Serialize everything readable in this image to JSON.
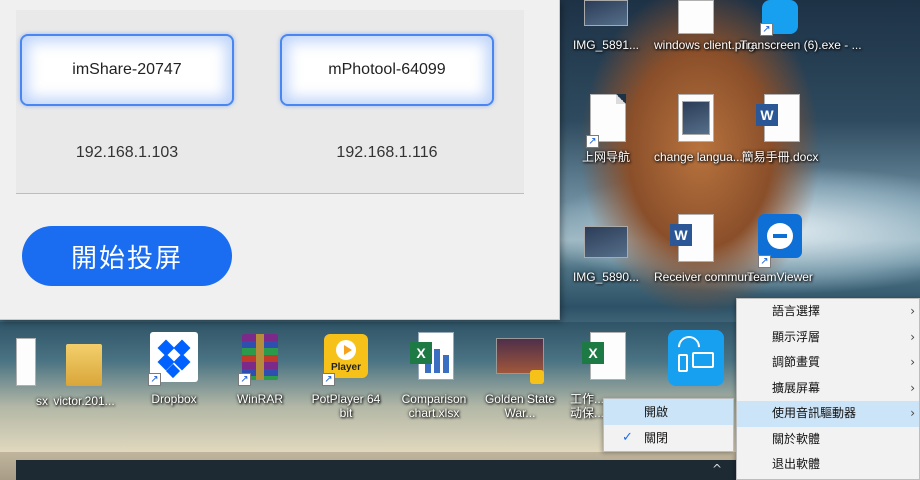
{
  "app_window": {
    "devices": [
      {
        "name": "imShare-20747",
        "ip": "192.168.1.103"
      },
      {
        "name": "mPhotool-64099",
        "ip": "192.168.1.116"
      }
    ],
    "start_button_label": "開始投屏"
  },
  "desktop_icons": {
    "top": [
      {
        "label": "IMG_5891...",
        "icon": "image-file-icon"
      },
      {
        "label": "windows client.png",
        "icon": "image-file-icon"
      },
      {
        "label": "Transcreen (6).exe - ...",
        "icon": "app-shortcut-icon"
      }
    ],
    "middle": [
      {
        "label": "上网导航",
        "icon": "blank-document-shortcut-icon"
      },
      {
        "label": "change langua...",
        "icon": "image-file-icon"
      },
      {
        "label": "簡易手冊.docx",
        "icon": "word-document-icon"
      }
    ],
    "third": [
      {
        "label": "IMG_5890...",
        "icon": "image-file-icon"
      },
      {
        "label": "Receiver communic...",
        "icon": "word-document-icon"
      },
      {
        "label": "TeamViewer",
        "icon": "teamviewer-icon"
      }
    ],
    "bottom": [
      {
        "label": "sx",
        "icon": "partial-file-icon"
      },
      {
        "label": "victor.201...",
        "icon": "folder-icon"
      },
      {
        "label": "Dropbox",
        "icon": "dropbox-icon"
      },
      {
        "label": "WinRAR",
        "icon": "winrar-icon"
      },
      {
        "label": "PotPlayer 64 bit",
        "icon": "potplayer-icon"
      },
      {
        "label": "Comparison chart.xlsx",
        "icon": "excel-chart-icon"
      },
      {
        "label": "Golden State War...",
        "icon": "video-file-icon"
      },
      {
        "label": "工作...\n动保...",
        "icon": "excel-file-icon"
      }
    ],
    "potplayer_badge": "Player"
  },
  "context_menu": {
    "items": [
      {
        "label": "語言選擇",
        "has_submenu": true
      },
      {
        "label": "顯示浮層",
        "has_submenu": true
      },
      {
        "label": "調節畫質",
        "has_submenu": true
      },
      {
        "label": "擴展屏幕",
        "has_submenu": true
      },
      {
        "label": "使用音訊驅動器",
        "has_submenu": true
      },
      {
        "label": "關於軟體",
        "has_submenu": false
      },
      {
        "label": "退出軟體",
        "has_submenu": false
      }
    ],
    "highlighted_index": 4,
    "arrow_glyph": "›"
  },
  "submenu": {
    "items": [
      {
        "label": "開啟",
        "checked": false
      },
      {
        "label": "關閉",
        "checked": true
      }
    ],
    "highlighted_index": 0,
    "check_glyph": "✓"
  },
  "taskbar": {
    "chevron_glyph": "^"
  },
  "colors": {
    "accent_blue": "#1a6df0",
    "menu_highlight": "#cce4f7",
    "card_border": "#4a86f2"
  }
}
